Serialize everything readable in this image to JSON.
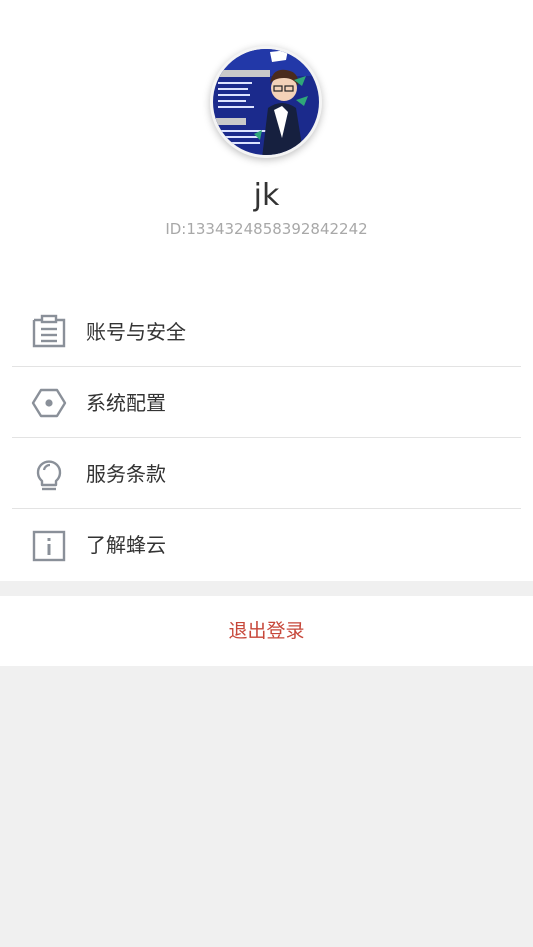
{
  "profile": {
    "username": "jk",
    "user_id": "ID:1334324858392842242"
  },
  "menu": {
    "items": [
      {
        "label": "账号与安全",
        "icon": "clipboard-list-icon"
      },
      {
        "label": "系统配置",
        "icon": "hex-nut-icon"
      },
      {
        "label": "服务条款",
        "icon": "lightbulb-icon"
      },
      {
        "label": "了解蜂云",
        "icon": "info-box-icon"
      }
    ]
  },
  "logout": {
    "label": "退出登录"
  },
  "colors": {
    "logout_text": "#c7473a",
    "icon_gray": "#8a9099",
    "background": "#f0f0f0"
  }
}
